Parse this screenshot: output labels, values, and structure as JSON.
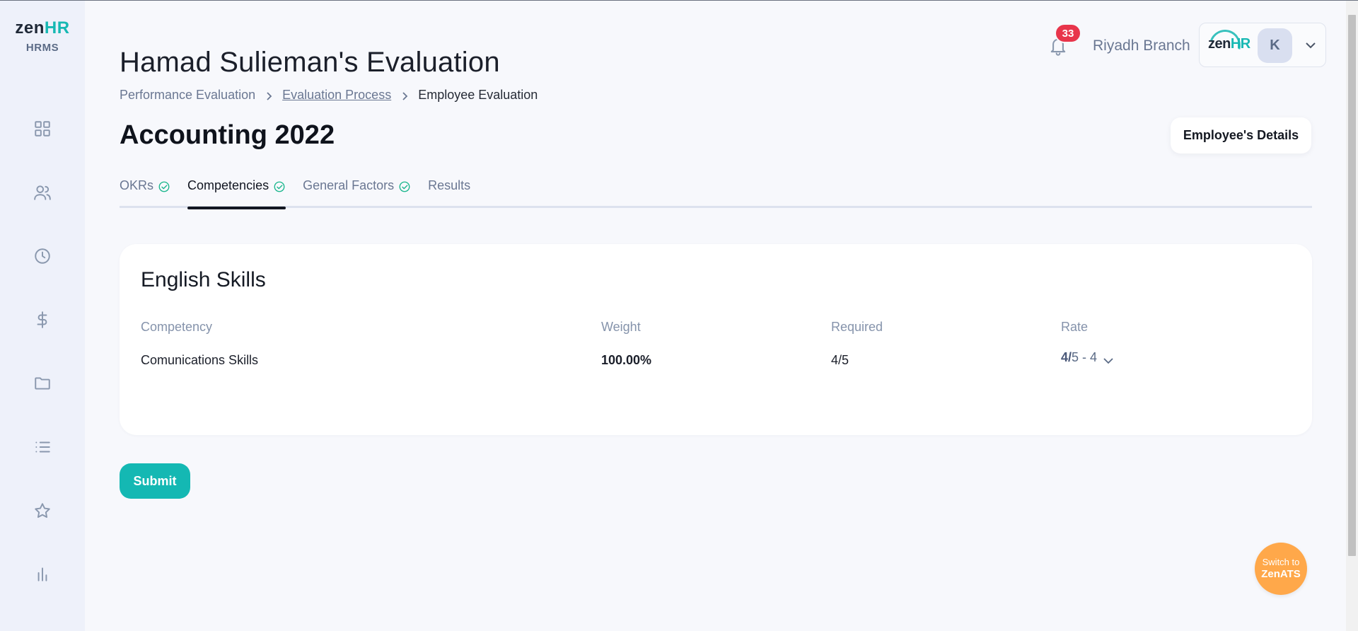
{
  "brand": {
    "logo_zen": "zen",
    "logo_hr": "HR",
    "subtitle": "HRMS"
  },
  "sidebar": {
    "items": [
      {
        "icon": "dashboard-grid-icon"
      },
      {
        "icon": "users-icon"
      },
      {
        "icon": "clock-icon"
      },
      {
        "icon": "dollar-icon"
      },
      {
        "icon": "folder-icon"
      },
      {
        "icon": "list-icon"
      },
      {
        "icon": "star-icon"
      },
      {
        "icon": "bar-chart-icon"
      }
    ]
  },
  "header": {
    "title": "Hamad Sulieman's Evaluation",
    "breadcrumb": [
      "Performance Evaluation",
      "Evaluation Process",
      "Employee Evaluation"
    ],
    "notifications_count": "33",
    "branch": "Riyadh Branch",
    "account_logo_zen": "zen",
    "account_logo_hr": "HR",
    "avatar_initial": "K"
  },
  "section": {
    "title": "Accounting 2022",
    "details_button": "Employee's Details"
  },
  "tabs": [
    {
      "label": "OKRs",
      "completed": true
    },
    {
      "label": "Competencies",
      "completed": true,
      "active": true
    },
    {
      "label": "General Factors",
      "completed": true
    },
    {
      "label": "Results",
      "completed": false
    }
  ],
  "card": {
    "title": "English Skills",
    "columns": [
      "Competency",
      "Weight",
      "Required",
      "Rate"
    ],
    "rows": [
      {
        "competency": "Comunications Skills",
        "weight": "100.00%",
        "required": "4/5",
        "rate_value": "4/",
        "rate_rest": "5 - 4"
      }
    ]
  },
  "actions": {
    "submit": "Submit"
  },
  "switch_ats": {
    "line1": "Switch to",
    "line2": "ZenATS"
  },
  "colors": {
    "accent": "#14b8b3",
    "badge": "#e8354b",
    "switch": "#ffa84a",
    "check": "#19b68c"
  }
}
